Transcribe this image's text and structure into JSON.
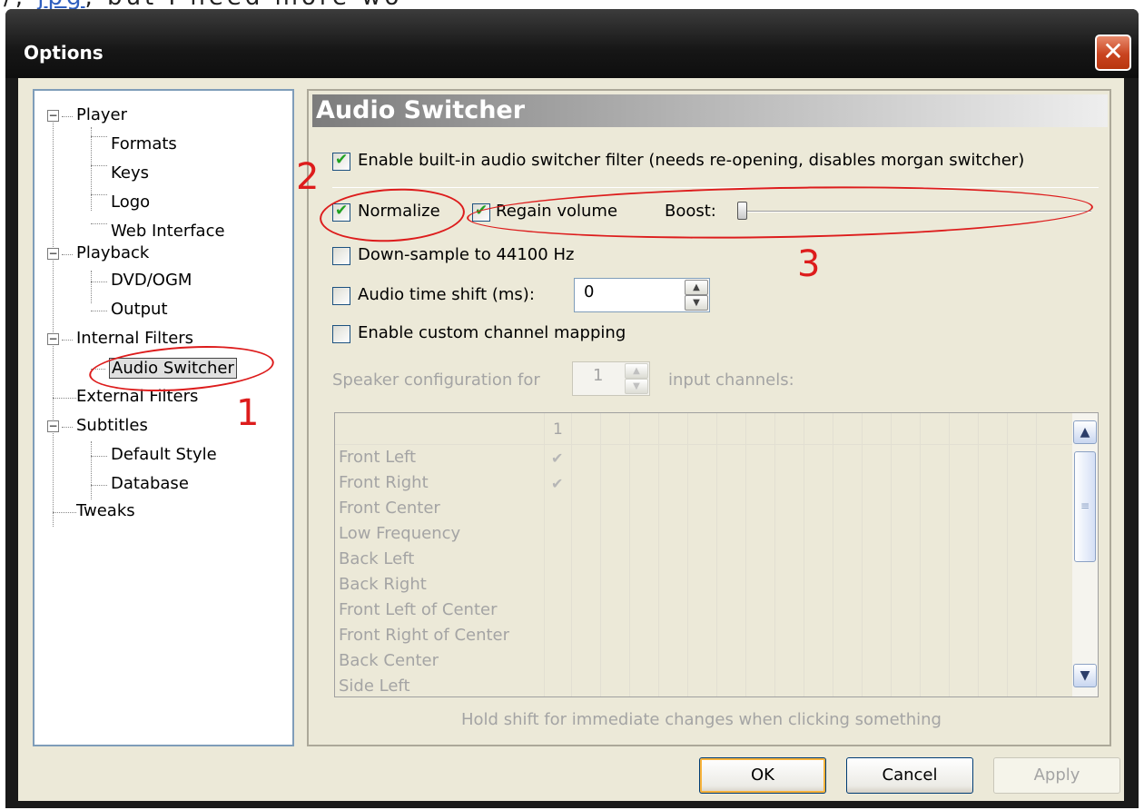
{
  "window": {
    "title": "Options",
    "close_glyph": "✕"
  },
  "top_fragment": {
    "text_before": "/,",
    "link": "jpg",
    "text_after": ", but I need more wo"
  },
  "tree": {
    "items": [
      {
        "label": "Player",
        "expander": "−"
      },
      {
        "label": "Formats"
      },
      {
        "label": "Keys"
      },
      {
        "label": "Logo"
      },
      {
        "label": "Web Interface"
      },
      {
        "label": "Playback",
        "expander": "−"
      },
      {
        "label": "DVD/OGM"
      },
      {
        "label": "Output"
      },
      {
        "label": "Internal Filters",
        "expander": "−"
      },
      {
        "label": "Audio Switcher",
        "selected": true
      },
      {
        "label": "External Filters"
      },
      {
        "label": "Subtitles",
        "expander": "−"
      },
      {
        "label": "Default Style"
      },
      {
        "label": "Database"
      },
      {
        "label": "Tweaks"
      }
    ]
  },
  "panel": {
    "title": "Audio Switcher",
    "enable_switcher": {
      "label": "Enable built-in audio switcher filter (needs re-opening, disables morgan switcher)",
      "checked": true
    },
    "normalize": {
      "label": "Normalize",
      "checked": true
    },
    "regain_volume": {
      "label": "Regain volume",
      "checked": true
    },
    "boost": {
      "label": "Boost:",
      "value_fraction": 0.0
    },
    "downsample": {
      "label": "Down-sample to 44100 Hz",
      "checked": false
    },
    "time_shift": {
      "label": "Audio time shift (ms):",
      "checked": false,
      "value": "0"
    },
    "custom_mapping": {
      "label": "Enable custom channel mapping",
      "checked": false
    },
    "speaker_config": {
      "label_before": "Speaker configuration for",
      "value": "1",
      "label_after": "input channels:"
    },
    "grid": {
      "column_header": "1",
      "rows": [
        {
          "label": "Front Left",
          "checked": true
        },
        {
          "label": "Front Right",
          "checked": true
        },
        {
          "label": "Front Center",
          "checked": false
        },
        {
          "label": "Low Frequency",
          "checked": false
        },
        {
          "label": "Back Left",
          "checked": false
        },
        {
          "label": "Back Right",
          "checked": false
        },
        {
          "label": "Front Left of Center",
          "checked": false
        },
        {
          "label": "Front Right of Center",
          "checked": false
        },
        {
          "label": "Back Center",
          "checked": false
        },
        {
          "label": "Side Left",
          "checked": false
        }
      ],
      "check_glyph": "✔",
      "scroll_up_glyph": "▲",
      "scroll_down_glyph": "▼",
      "thumb_grip_glyph": "≡"
    },
    "hint": "Hold shift for immediate changes when clicking something"
  },
  "buttons": {
    "ok": "OK",
    "cancel": "Cancel",
    "apply": "Apply"
  },
  "spin_up_glyph": "▲",
  "spin_down_glyph": "▼",
  "annotations": {
    "one": "1",
    "two": "2",
    "three": "3"
  },
  "colors": {
    "annotation": "#dd1c1c",
    "selection_border": "#f8b33b",
    "check": "#21a121",
    "tree_border": "#7f9db9"
  }
}
